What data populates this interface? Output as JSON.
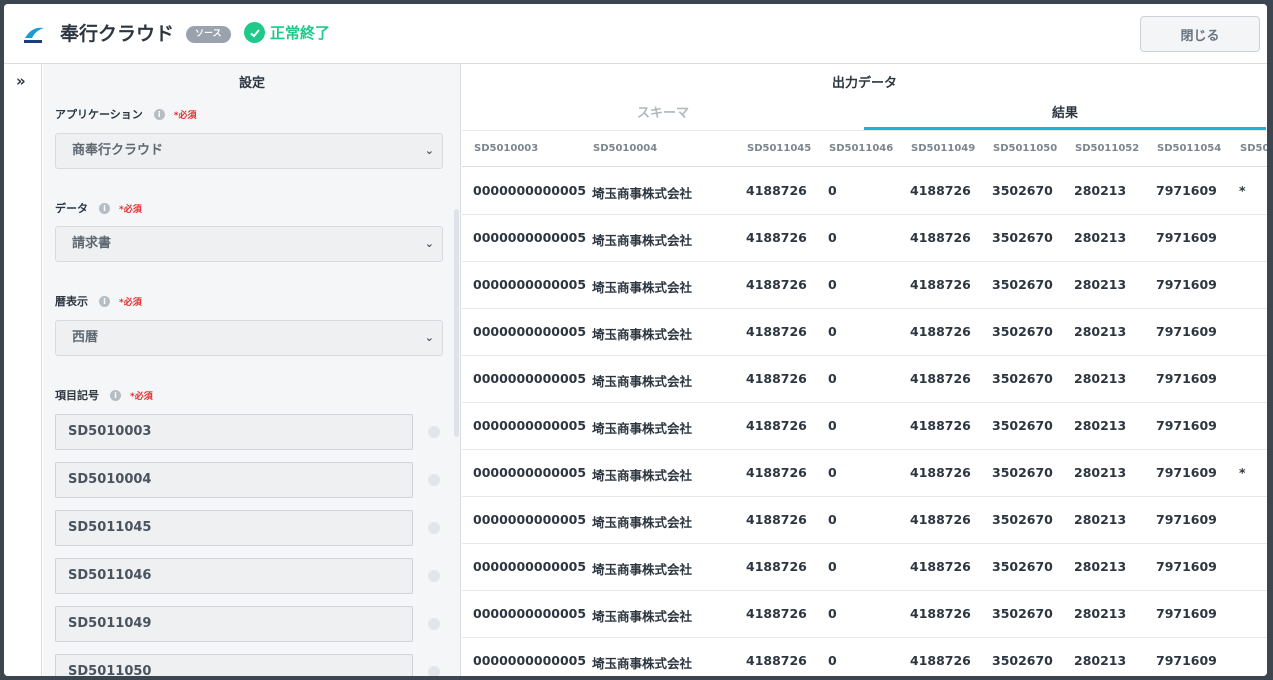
{
  "header": {
    "title": "奉行クラウド",
    "badge": "ソース",
    "status": "正常終了",
    "close_label": "閉じる"
  },
  "settings": {
    "title": "設定",
    "required_label": "*必須",
    "fields": [
      {
        "label": "アプリケーション",
        "value": "商奉行クラウド"
      },
      {
        "label": "データ",
        "value": "請求書"
      },
      {
        "label": "暦表示",
        "value": "西暦"
      }
    ],
    "item_codes_label": "項目記号",
    "item_codes": [
      "SD5010003",
      "SD5010004",
      "SD5011045",
      "SD5011046",
      "SD5011049",
      "SD5011050"
    ]
  },
  "output": {
    "title": "出力データ",
    "tabs": [
      "スキーマ",
      "結果"
    ],
    "active_tab": "結果",
    "columns": [
      "SD5010003",
      "SD5010004",
      "SD5011045",
      "SD5011046",
      "SD5011049",
      "SD5011050",
      "SD5011052",
      "SD5011054",
      "SD50"
    ],
    "rows": [
      [
        "0000000000005",
        "埼玉商事株式会社",
        "4188726",
        "0",
        "4188726",
        "3502670",
        "280213",
        "7971609",
        "*"
      ],
      [
        "0000000000005",
        "埼玉商事株式会社",
        "4188726",
        "0",
        "4188726",
        "3502670",
        "280213",
        "7971609",
        ""
      ],
      [
        "0000000000005",
        "埼玉商事株式会社",
        "4188726",
        "0",
        "4188726",
        "3502670",
        "280213",
        "7971609",
        ""
      ],
      [
        "0000000000005",
        "埼玉商事株式会社",
        "4188726",
        "0",
        "4188726",
        "3502670",
        "280213",
        "7971609",
        ""
      ],
      [
        "0000000000005",
        "埼玉商事株式会社",
        "4188726",
        "0",
        "4188726",
        "3502670",
        "280213",
        "7971609",
        ""
      ],
      [
        "0000000000005",
        "埼玉商事株式会社",
        "4188726",
        "0",
        "4188726",
        "3502670",
        "280213",
        "7971609",
        ""
      ],
      [
        "0000000000005",
        "埼玉商事株式会社",
        "4188726",
        "0",
        "4188726",
        "3502670",
        "280213",
        "7971609",
        "*"
      ],
      [
        "0000000000005",
        "埼玉商事株式会社",
        "4188726",
        "0",
        "4188726",
        "3502670",
        "280213",
        "7971609",
        ""
      ],
      [
        "0000000000005",
        "埼玉商事株式会社",
        "4188726",
        "0",
        "4188726",
        "3502670",
        "280213",
        "7971609",
        ""
      ],
      [
        "0000000000005",
        "埼玉商事株式会社",
        "4188726",
        "0",
        "4188726",
        "3502670",
        "280213",
        "7971609",
        ""
      ],
      [
        "0000000000005",
        "埼玉商事株式会社",
        "4188726",
        "0",
        "4188726",
        "3502670",
        "280213",
        "7971609",
        ""
      ]
    ]
  },
  "colors": {
    "accent": "#1ab0e0",
    "success": "#1ec98a",
    "required": "#e0302f"
  }
}
